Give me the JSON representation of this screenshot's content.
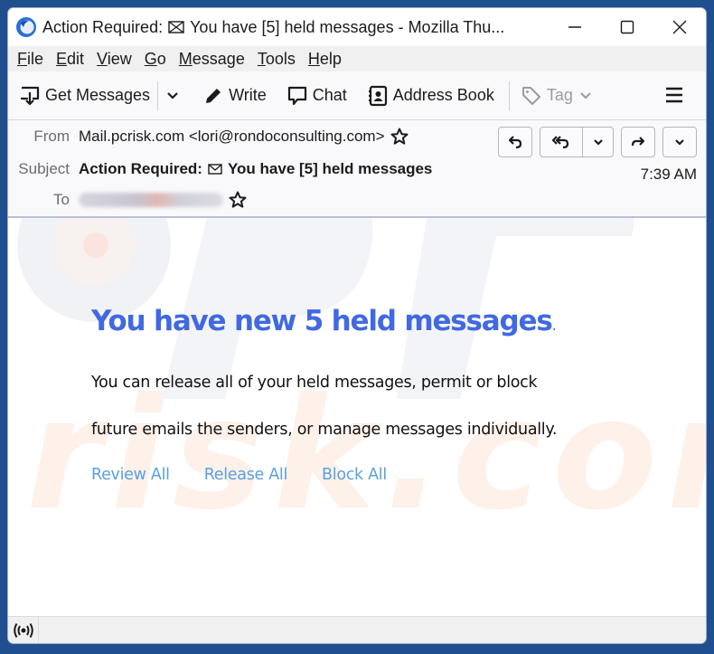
{
  "window": {
    "title_prefix": "Action Required:",
    "title_suffix": "You have [5] held messages - Mozilla Thu...",
    "controls": [
      "minimize",
      "maximize",
      "close"
    ]
  },
  "menubar": {
    "items": [
      {
        "accel": "F",
        "rest": "ile"
      },
      {
        "accel": "E",
        "rest": "dit"
      },
      {
        "accel": "V",
        "rest": "iew"
      },
      {
        "accel": "G",
        "rest": "o"
      },
      {
        "accel": "M",
        "rest": "essage"
      },
      {
        "accel": "T",
        "rest": "ools"
      },
      {
        "accel": "H",
        "rest": "elp"
      }
    ]
  },
  "toolbar": {
    "get_messages": "Get Messages",
    "write": "Write",
    "chat": "Chat",
    "address_book": "Address Book",
    "tag": "Tag"
  },
  "header": {
    "from_label": "From",
    "from_value": "Mail.pcrisk.com <lori@rondoconsulting.com>",
    "subject_label": "Subject",
    "subject_prefix": "Action Required:",
    "subject_suffix": "You have [5] held messages",
    "to_label": "To",
    "date": "7:39 AM"
  },
  "body": {
    "headline": "You have new 5 held messages",
    "headline_dot": ".",
    "para1": "You can release all of your held messages, permit or block",
    "para2": "future emails the senders, or manage messages individually.",
    "links": [
      "Review All",
      "Release All",
      "Block All"
    ]
  },
  "colors": {
    "headline": "#4169e1",
    "link": "#5aa0e0",
    "desktop": "#1f4f8f"
  }
}
